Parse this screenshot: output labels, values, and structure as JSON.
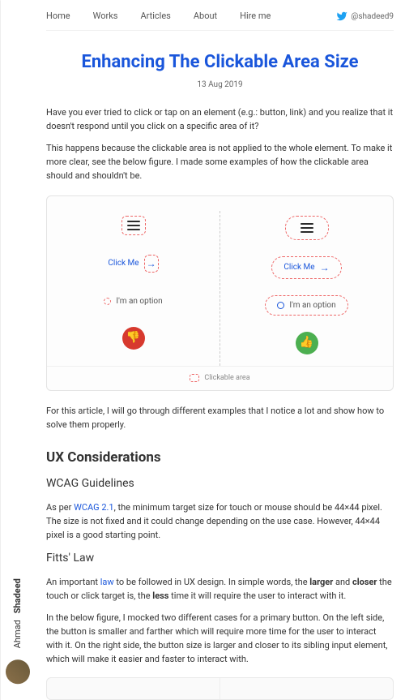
{
  "author": {
    "first": "Ahmad",
    "last": "Shadeed"
  },
  "nav": {
    "home": "Home",
    "works": "Works",
    "articles": "Articles",
    "about": "About",
    "hire": "Hire me"
  },
  "social": {
    "handle": "@shadeed9"
  },
  "article": {
    "title": "Enhancing The Clickable Area Size",
    "date": "13 Aug 2019",
    "p1": "Have you ever tried to click or tap on an element (e.g.: button, link) and you realize that it doesn't respond until you click on a specific area of it?",
    "p2": "This happens because the clickable area is not applied to the whole element. To make it more clear, see the below figure. I made some examples of how the clickable area should and shouldn't be.",
    "p3": "For this article, I will go through different examples that I notice a lot and show how to solve them properly."
  },
  "figure": {
    "clickme": "Click Me",
    "option": "I'm an option",
    "legend": "Clickable area"
  },
  "ux": {
    "heading": "UX Considerations",
    "wcag_h": "WCAG Guidelines",
    "wcag_p_pre": "As per ",
    "wcag_link": "WCAG 2.1",
    "wcag_p_post": ", the minimum target size for touch or mouse should be 44×44 pixel. The size is not fixed and it could change depending on the use case. However, 44×44 pixel is a good starting point.",
    "fitts_h": "Fitts' Law",
    "fitts_p_pre": "An important ",
    "fitts_link": "law",
    "fitts_p_mid1": " to be followed in UX design. In simple words, the ",
    "fitts_bold1": "larger",
    "fitts_and": " and ",
    "fitts_bold2": "closer",
    "fitts_p_mid2": " the touch or click target is, the ",
    "fitts_bold3": "less",
    "fitts_p_post": " time it will require the user to interact with it.",
    "fitts_p2": "In the below figure, I mocked two different cases for a primary button. On the left side, the button is smaller and farther which will require more time for the user to interact with it. On the right side, the button size is larger and closer to its sibling input element, which will make it easier and faster to interact with."
  }
}
